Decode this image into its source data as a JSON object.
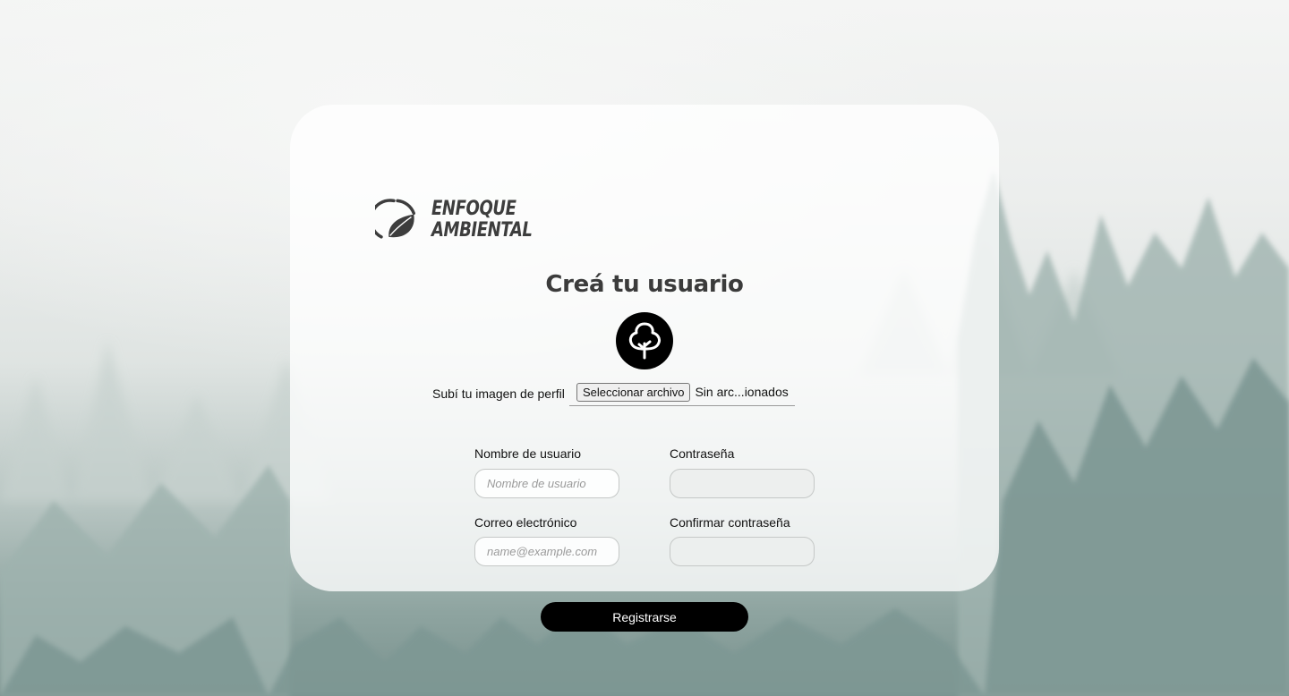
{
  "brand": {
    "logo_icon": "leaf-circle-icon",
    "name_line1": "ENFOQUE",
    "name_line2": "AMBIENTAL"
  },
  "form": {
    "title": "Creá tu usuario",
    "avatar_icon": "tree-icon",
    "upload_label": "Subí tu imagen de perfil",
    "upload_button": "Seleccionar archivo",
    "upload_status": "Sin arc...ionados",
    "username_label": "Nombre de usuario",
    "username_placeholder": "Nombre de usuario",
    "password_label": "Contraseña",
    "email_label": "Correo electrónico",
    "email_placeholder": "name@example.com",
    "confirm_label": "Confirmar contraseña",
    "submit_label": "Registrarse"
  },
  "colors": {
    "button_bg": "#000000",
    "button_text": "#ffffff",
    "title": "#3b3b3b"
  }
}
